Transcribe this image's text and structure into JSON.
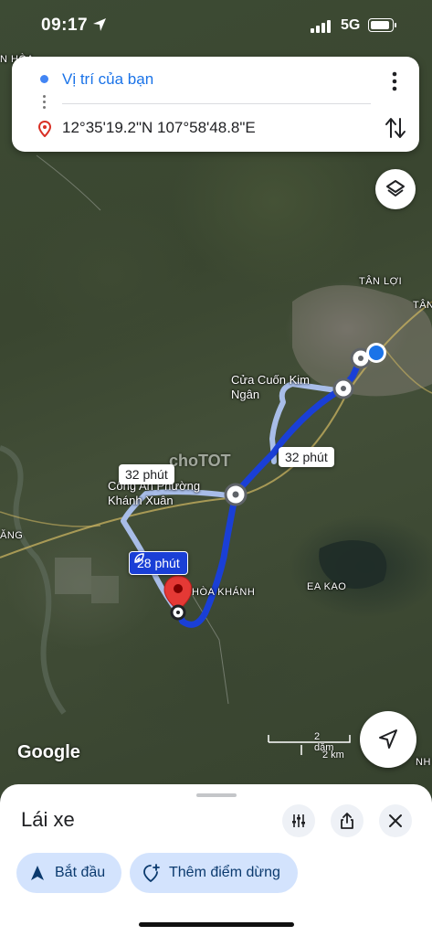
{
  "status_bar": {
    "time": "09:17",
    "network": "5G",
    "icons": [
      "location-arrow-icon",
      "signal-icon",
      "battery-icon"
    ]
  },
  "directions": {
    "origin": "Vị trí của bạn",
    "destination": "12°35'19.2\"N 107°58'48.8\"E",
    "icons": [
      "origin-dot-icon",
      "destination-pin-icon",
      "more-vert-icon",
      "swap-icon"
    ]
  },
  "map": {
    "place_labels": {
      "tan_loi": "TÂN LỢI",
      "tan_edge": "TÂN",
      "hoa_edge": "N HÒA",
      "cua_cuon": "Cửa Cuốn Kim\nNgân",
      "cong_an": "Công An Phường\nKhánh Xuân",
      "hoa_khanh": "HÒA KHÁNH",
      "ea_kao": "EA KAO",
      "ang_edge": "ĂNG",
      "hanh_edge": "NH"
    },
    "watermark": "choTOT",
    "route_badges": {
      "primary": "28 phút",
      "alt_right": "32 phút",
      "alt_left": "32 phút"
    },
    "google_logo": "Google",
    "scale": {
      "imperial": "2 dặm",
      "metric": "2 km"
    },
    "colors": {
      "route": "#1a3fd6",
      "alt_route": "#a8bde8",
      "pin": "#e53935"
    }
  },
  "sheet": {
    "mode": "Lái xe",
    "start_label": "Bắt đầu",
    "add_stop_label": "Thêm điểm dừng",
    "icons": [
      "options-icon",
      "share-icon",
      "close-icon",
      "navigate-arrow-icon",
      "add-stop-icon"
    ]
  }
}
